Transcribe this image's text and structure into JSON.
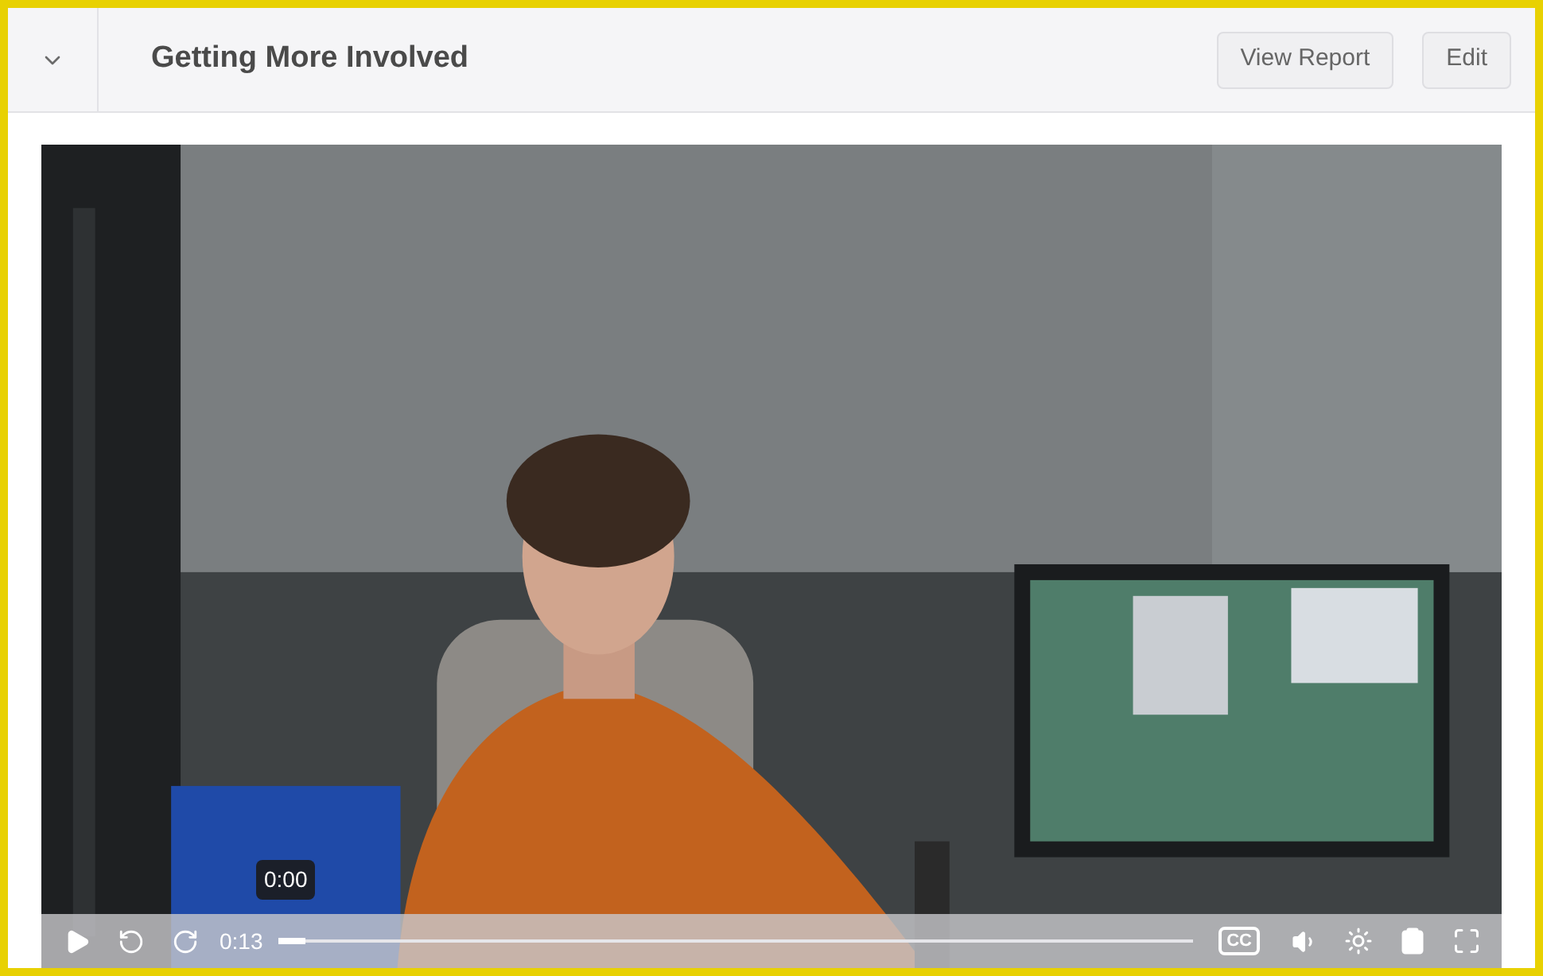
{
  "section": {
    "title": "Getting More Involved",
    "expanded": true
  },
  "actions": [
    "View Report",
    "Edit"
  ],
  "video": {
    "player": {
      "playing": false,
      "time": "0:13",
      "hover_time": "0:00",
      "level": 0.03,
      "captions_label": "CC"
    }
  }
}
